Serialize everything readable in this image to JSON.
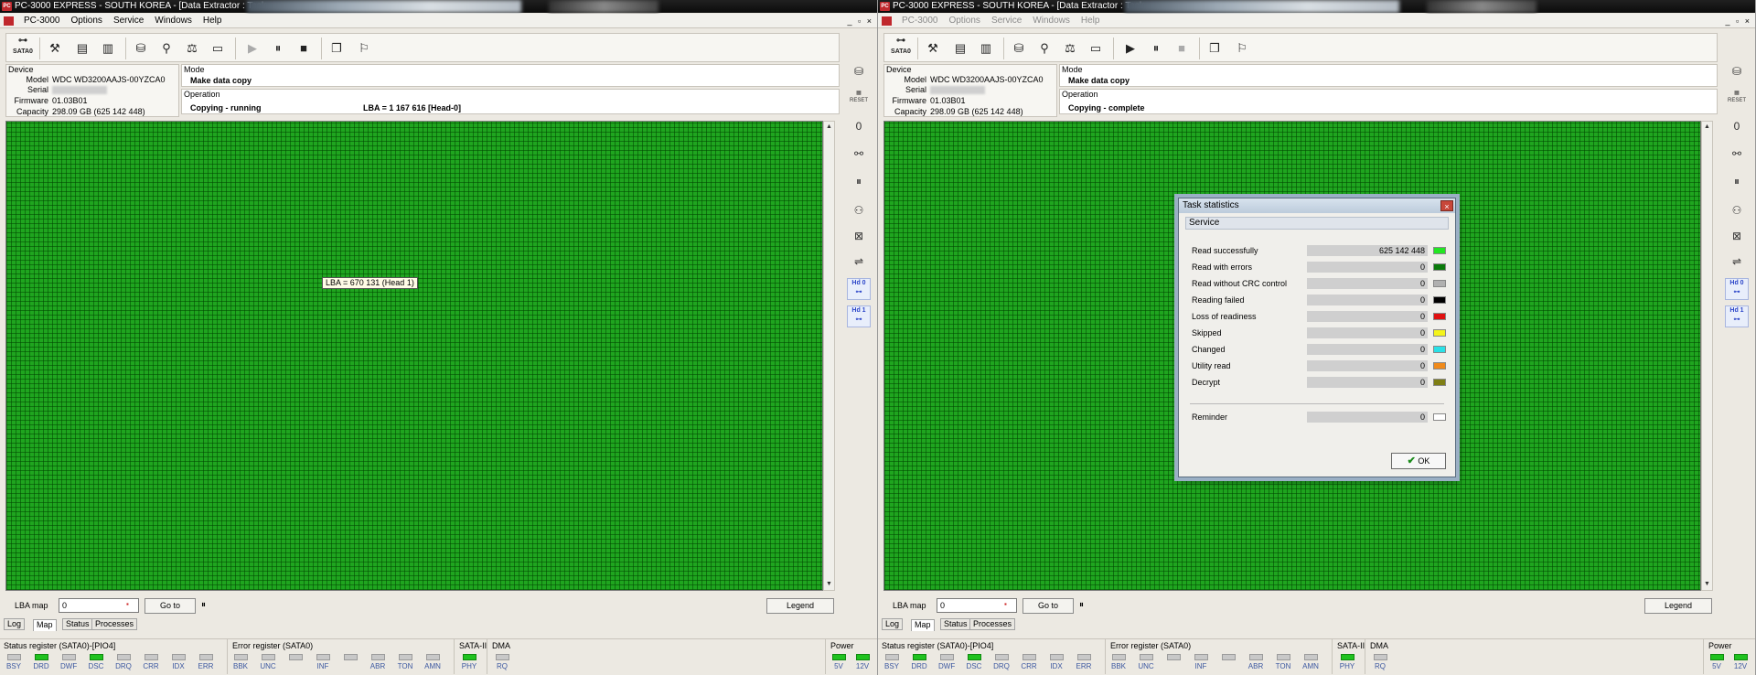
{
  "panes": [
    {
      "title": "PC-3000 EXPRESS - SOUTH KOREA - [Data Extractor : Task -",
      "app_icon": "PC",
      "menu": [
        "PC-3000",
        "Options",
        "Service",
        "Windows",
        "Help"
      ],
      "mdi_buttons": "_ ▫ ×",
      "toolbar_sata_label": "SATA0",
      "device": {
        "group": "Device",
        "model_label": "Model",
        "model": "WDC WD3200AAJS-00YZCA0",
        "serial_label": "Serial",
        "firmware_label": "Firmware",
        "firmware": "01.03B01",
        "capacity_label": "Capacity",
        "capacity": "298.09 GB (625 142 448)"
      },
      "mode": {
        "group": "Mode",
        "value": "Make data copy"
      },
      "operation": {
        "group": "Operation",
        "value": "Copying - running",
        "lba": "LBA =     1 167 616  [Head-0]"
      },
      "tooltip": "LBA =    670 131 (Head 1)",
      "lba_map": {
        "label": "LBA map",
        "value": "0",
        "goto": "Go to",
        "pause": "⏸",
        "legend": "Legend"
      },
      "tabs": [
        "Log",
        "Map",
        "Status",
        "Processes"
      ],
      "active_tab": 1
    },
    {
      "title": "PC-3000 EXPRESS - SOUTH KOREA - [Data Extractor : Task",
      "app_icon": "PC",
      "menu": [
        "PC-3000",
        "Options",
        "Service",
        "Windows",
        "Help"
      ],
      "mdi_buttons": "_ ▫ ×",
      "toolbar_sata_label": "SATA0",
      "device": {
        "group": "Device",
        "model_label": "Model",
        "model": "WDC WD3200AAJS-00YZCA0",
        "serial_label": "Serial",
        "firmware_label": "Firmware",
        "firmware": "01.03B01",
        "capacity_label": "Capacity",
        "capacity": "298.09 GB (625 142 448)"
      },
      "mode": {
        "group": "Mode",
        "value": "Make data copy"
      },
      "operation": {
        "group": "Operation",
        "value": "Copying - complete",
        "lba": ""
      },
      "lba_map": {
        "label": "LBA map",
        "value": "0",
        "goto": "Go to",
        "pause": "⏸",
        "legend": "Legend"
      },
      "tabs": [
        "Log",
        "Map",
        "Status",
        "Processes"
      ],
      "active_tab": 1
    }
  ],
  "status_bar": {
    "status_register": "Status register (SATA0)-[PIO4]",
    "status_leds": [
      {
        "label": "BSY",
        "on": false
      },
      {
        "label": "DRD",
        "on": true
      },
      {
        "label": "DWF",
        "on": false
      },
      {
        "label": "DSC",
        "on": true
      },
      {
        "label": "DRQ",
        "on": false
      },
      {
        "label": "CRR",
        "on": false
      },
      {
        "label": "IDX",
        "on": false
      },
      {
        "label": "ERR",
        "on": false
      }
    ],
    "error_register": "Error register (SATA0)",
    "error_leds": [
      {
        "label": "BBK",
        "on": false
      },
      {
        "label": "UNC",
        "on": false
      },
      {
        "label": "",
        "on": false
      },
      {
        "label": "INF",
        "on": false
      },
      {
        "label": "",
        "on": false
      },
      {
        "label": "ABR",
        "on": false
      },
      {
        "label": "TON",
        "on": false
      },
      {
        "label": "AMN",
        "on": false
      }
    ],
    "sata_label": "SATA-II",
    "sata_leds": [
      {
        "label": "PHY",
        "on": true
      }
    ],
    "dma_label": "DMA",
    "dma_leds": [
      {
        "label": "RQ",
        "on": false
      }
    ],
    "power_label": "Power",
    "power_leds": [
      {
        "label": "5V",
        "on": true
      },
      {
        "label": "12V",
        "on": true
      }
    ]
  },
  "dialog": {
    "title": "Task statistics",
    "close": "×",
    "section": "Service",
    "rows": [
      {
        "label": "Read successfully",
        "value": "625 142 448",
        "color": "#22e622"
      },
      {
        "label": "Read with errors",
        "value": "0",
        "color": "#0a7a0a"
      },
      {
        "label": "Read without CRC control",
        "value": "0",
        "color": "#b0b0b0"
      },
      {
        "label": "Reading failed",
        "value": "0",
        "color": "#000000"
      },
      {
        "label": "Loss of readiness",
        "value": "0",
        "color": "#e01010"
      },
      {
        "label": "Skipped",
        "value": "0",
        "color": "#f4f41a"
      },
      {
        "label": "Changed",
        "value": "0",
        "color": "#2ae0e6"
      },
      {
        "label": "Utility read",
        "value": "0",
        "color": "#f08a1a"
      },
      {
        "label": "Decrypt",
        "value": "0",
        "color": "#7e7e14"
      }
    ],
    "reminder": {
      "label": "Reminder",
      "value": "0",
      "color": "#ffffff"
    },
    "ok_label": "OK"
  }
}
